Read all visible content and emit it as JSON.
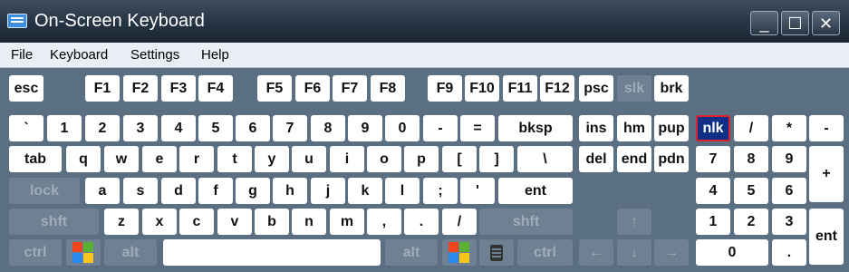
{
  "window": {
    "title": "On-Screen Keyboard",
    "controls": {
      "minimize": "_",
      "maximize": "☐",
      "close": "✕"
    }
  },
  "menu": [
    "File",
    "Keyboard",
    "Settings",
    "Help"
  ],
  "keys": {
    "esc": "esc",
    "f1": "F1",
    "f2": "F2",
    "f3": "F3",
    "f4": "F4",
    "f5": "F5",
    "f6": "F6",
    "f7": "F7",
    "f8": "F8",
    "f9": "F9",
    "f10": "F10",
    "f11": "F11",
    "f12": "F12",
    "psc": "psc",
    "slk": "slk",
    "brk": "brk",
    "backtick": "`",
    "n1": "1",
    "n2": "2",
    "n3": "3",
    "n4": "4",
    "n5": "5",
    "n6": "6",
    "n7": "7",
    "n8": "8",
    "n9": "9",
    "n0": "0",
    "minus": "-",
    "equals": "=",
    "bksp": "bksp",
    "ins": "ins",
    "hm": "hm",
    "pup": "pup",
    "nlk": "nlk",
    "np_div": "/",
    "np_mul": "*",
    "np_sub": "-",
    "tab": "tab",
    "q": "q",
    "w": "w",
    "e": "e",
    "r": "r",
    "t": "t",
    "y": "y",
    "u": "u",
    "i": "i",
    "o": "o",
    "p": "p",
    "lbracket": "[",
    "rbracket": "]",
    "backslash": "\\",
    "del": "del",
    "end": "end",
    "pdn": "pdn",
    "np7": "7",
    "np8": "8",
    "np9": "9",
    "np_add": "+",
    "lock": "lock",
    "a": "a",
    "s": "s",
    "d": "d",
    "f": "f",
    "g": "g",
    "h": "h",
    "j": "j",
    "k": "k",
    "l": "l",
    "semicolon": ";",
    "quote": "'",
    "ent": "ent",
    "np4": "4",
    "np5": "5",
    "np6": "6",
    "lshft": "shft",
    "z": "z",
    "x": "x",
    "c": "c",
    "v": "v",
    "b": "b",
    "n": "n",
    "m": "m",
    "comma": ",",
    "period": ".",
    "slash": "/",
    "rshft": "shft",
    "up": "↑",
    "np1": "1",
    "np2": "2",
    "np3": "3",
    "np_ent": "ent",
    "lctrl": "ctrl",
    "lalt": "alt",
    "space": "",
    "ralt": "alt",
    "rctrl": "ctrl",
    "left": "←",
    "down": "↓",
    "right": "→",
    "np0": "0",
    "np_dot": "."
  },
  "active_key": "nlk",
  "colors": {
    "background": "#5b6f83",
    "key": "#ffffff",
    "key_dim": "#6f8092",
    "active_key": "#0e2f86"
  },
  "icons": {
    "app": "keyboard-icon",
    "windows": "windows-logo-icon",
    "context_menu": "menu-key-icon"
  }
}
